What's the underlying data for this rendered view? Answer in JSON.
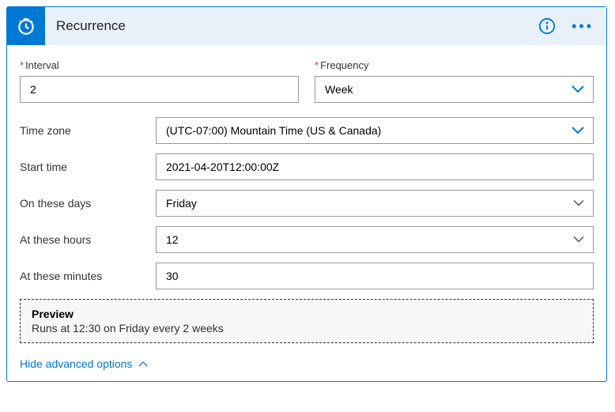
{
  "header": {
    "title": "Recurrence"
  },
  "fields": {
    "interval": {
      "label": "Interval",
      "value": "2"
    },
    "frequency": {
      "label": "Frequency",
      "value": "Week"
    },
    "timezone": {
      "label": "Time zone",
      "value": "(UTC-07:00) Mountain Time (US & Canada)"
    },
    "start_time": {
      "label": "Start time",
      "value": "2021-04-20T12:00:00Z"
    },
    "on_days": {
      "label": "On these days",
      "value": "Friday"
    },
    "at_hours": {
      "label": "At these hours",
      "value": "12"
    },
    "at_minutes": {
      "label": "At these minutes",
      "value": "30"
    }
  },
  "preview": {
    "title": "Preview",
    "text": "Runs at 12:30 on Friday every 2 weeks"
  },
  "toggle": {
    "label": "Hide advanced options"
  },
  "colors": {
    "accent": "#0078d4",
    "required": "#d13438"
  }
}
